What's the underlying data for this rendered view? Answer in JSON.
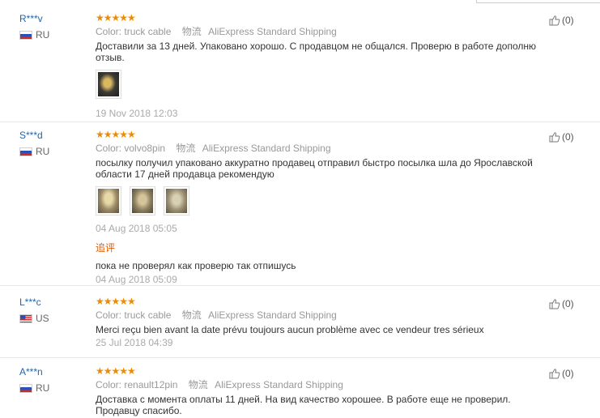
{
  "meta_label": "Color:",
  "ship_label": "物流",
  "append_label": "追评",
  "helpful_icon": "thumbs-up-icon",
  "colors": {
    "name": "#2266aa",
    "stars": "#f08a00",
    "append": "#e05a00"
  },
  "reviews": [
    {
      "user": "R***v",
      "country": "RU",
      "stars": "★★★★★",
      "color": "truck cable",
      "shipping": "AliExpress Standard Shipping",
      "text": "Доставили за 13 дней. Упаковано хорошо. С продавцом не общался. Проверю в работе дополню отзыв.",
      "date": "19 Nov 2018 12:03",
      "helpful": "(0)"
    },
    {
      "user": "S***d",
      "country": "RU",
      "stars": "★★★★★",
      "color": "volvo8pin",
      "shipping": "AliExpress Standard Shipping",
      "text": "посылку получил упаковано аккуратно продавец отправил быстро посылка шла до Ярославской области 17 дней продавца рекомендую",
      "date": "04 Aug 2018 05:05",
      "append_text": "пока не проверял как проверю так отпишусь",
      "append_date": "04 Aug 2018 05:09",
      "helpful": "(0)"
    },
    {
      "user": "L***c",
      "country": "US",
      "stars": "★★★★★",
      "color": "truck cable",
      "shipping": "AliExpress Standard Shipping",
      "text": "Merci reçu bien avant la date prévu toujours aucun problème avec ce vendeur tres sérieux",
      "date": "25 Jul 2018 04:39",
      "helpful": "(0)"
    },
    {
      "user": "A***n",
      "country": "RU",
      "stars": "★★★★★",
      "color": "renault12pin",
      "shipping": "AliExpress Standard Shipping",
      "text": "Доставка с момента оплаты 11 дней. На вид качество хорошее. В работе еще не проверил. Продавцу спасибо.",
      "helpful": "(0)"
    }
  ]
}
